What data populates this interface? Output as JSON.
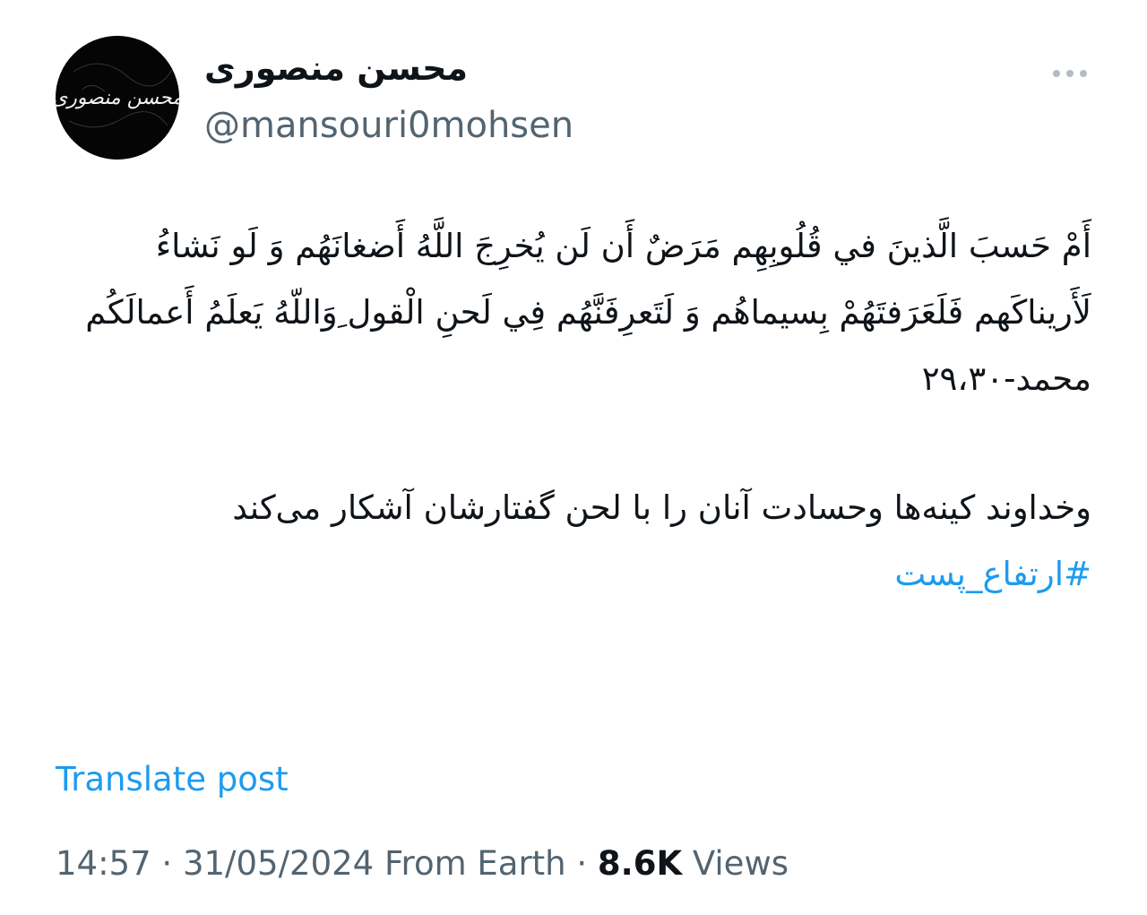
{
  "author": {
    "display_name": "محسن منصوری",
    "handle": "@mansouri0mohsen",
    "avatar_text": "محسن منصوری"
  },
  "more_icon": "more-horizontal-icon",
  "tweet": {
    "quran_text": "أَمْ حَسبَ الَّذينَ في قُلُوبِهِم مَرَضٌ أَن لَن يُخرِجَ اللَّهُ أَضغانَهُم وَ لَو نَشاءُ لَأَريناكَهم فَلَعَرَفتَهُمْ بِسيماهُم وَ لَتَعرِفَنَّهُم فِي لَحنِ الْقول ِوَاللّهُ يَعلَمُ أَعمالَكُم محمد-۲۹،۳۰",
    "persian_text": "وخداوند کینه‌ها وحسادت آنان را با لحن گفتارشان آشکار می‌کند",
    "hashtag": "#ارتفاع_پست"
  },
  "translate_label": "Translate post",
  "meta": {
    "time": "14:57",
    "separator": "·",
    "date": "31/05/2024",
    "source": "From Earth",
    "views_count": "8.6K",
    "views_label": "Views"
  },
  "colors": {
    "link": "#1d9bf0",
    "secondary": "#536471",
    "primary": "#0f1419"
  }
}
